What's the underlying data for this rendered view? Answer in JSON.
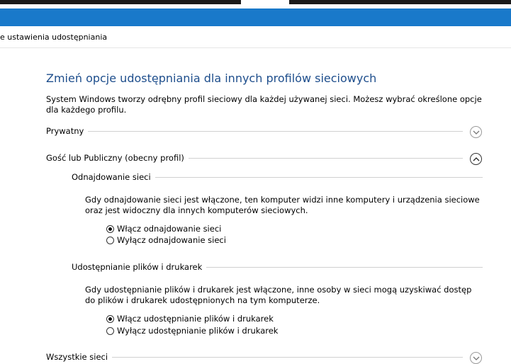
{
  "breadcrumb": "e ustawienia udostępniania",
  "main": {
    "title": "Zmień opcje udostępniania dla innych profilów sieciowych",
    "description": "System Windows tworzy odrębny profil sieciowy dla każdej używanej sieci. Możesz wybrać określone opcje dla każdego profilu."
  },
  "profiles": {
    "private": {
      "label": "Prywatny",
      "expanded": false
    },
    "guest": {
      "label": "Gość lub Publiczny (obecny profil)",
      "expanded": true
    },
    "all": {
      "label": "Wszystkie sieci",
      "expanded": false
    }
  },
  "network_discovery": {
    "label": "Odnajdowanie sieci",
    "description": "Gdy odnajdowanie sieci jest włączone, ten komputer widzi inne komputery i urządzenia sieciowe oraz jest widoczny dla innych komputerów sieciowych.",
    "options": [
      "Włącz odnajdowanie sieci",
      "Wyłącz odnajdowanie sieci"
    ],
    "selected": 0
  },
  "file_sharing": {
    "label": "Udostępnianie plików i drukarek",
    "description": "Gdy udostępnianie plików i drukarek jest włączone, inne osoby w sieci mogą uzyskiwać dostęp do plików i drukarek udostępnionych na tym komputerze.",
    "options": [
      "Włącz udostępnianie plików i drukarek",
      "Wyłącz udostępnianie plików i drukarek"
    ],
    "selected": 0
  },
  "colors": {
    "title_bar": "#1979ca",
    "heading": "#1e4e8c"
  }
}
